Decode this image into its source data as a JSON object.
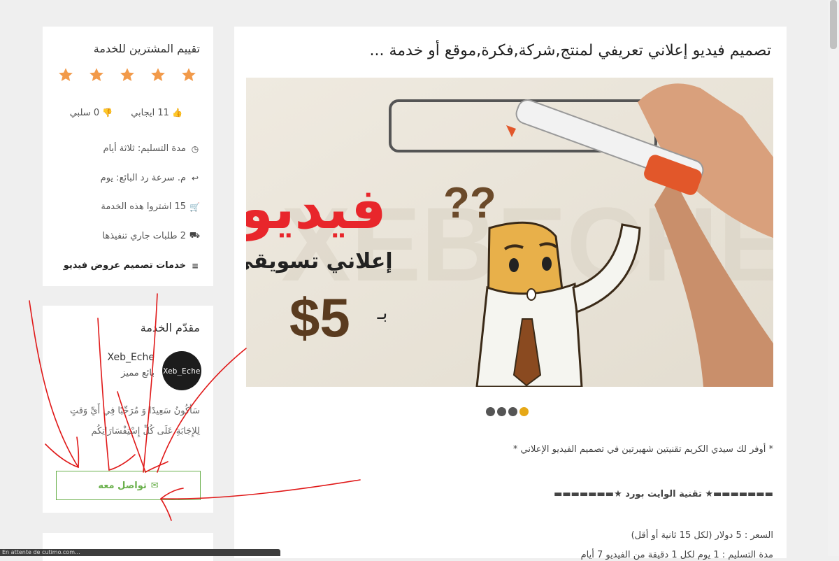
{
  "main": {
    "title": "تصميم فيديو إعلاني تعريفي لمنتج,شركة,فكرة,موقع أو خدمة ...",
    "hero": {
      "big_word": "فيديو",
      "sub_word": "إعلاني تسويقي",
      "price_prefix": "بـ",
      "price": "$5",
      "watermark": "XEBECHE",
      "question_marks": "??"
    },
    "slides": 4,
    "active_slide": 4,
    "description": [
      "* أوفر لك سيدي الكريم تقنيتين شهيرتين في تصميم الفيديو الإعلاني *",
      "▬▬▬▬▬▬▬★ تقنية الوايت بورد ★▬▬▬▬▬▬▬",
      "السعر : 5 دولار (لكل 15 ثانية أو أقل)",
      "مدة التسليم : 1 يوم لكل 1 دقيقة من الفيديو 7 أيام"
    ]
  },
  "rating": {
    "title": "تقييم المشترين للخدمة",
    "stars": 5,
    "star_color": "#f29a4a",
    "positive": "11 ايجابي",
    "negative": "0 سلبي",
    "rows": [
      {
        "icon": "clock-icon",
        "glyph": "◷",
        "text": "مدة التسليم: ثلاثة أيام"
      },
      {
        "icon": "reply-icon",
        "glyph": "↩",
        "text": "م. سرعة رد البائع: يوم"
      },
      {
        "icon": "cart-icon",
        "glyph": "🛒",
        "text": "15 اشتروا هذه الخدمة"
      },
      {
        "icon": "truck-icon",
        "glyph": "⛟",
        "text": "2 طلبات جاري تنفيذها"
      },
      {
        "icon": "list-icon",
        "glyph": "≡",
        "text": "خدمات تصميم عروض فيديو"
      }
    ]
  },
  "provider": {
    "title": "مقدّم الخدمة",
    "name": "Xeb_Eche",
    "level": "بائع مميز",
    "avatar_text": "Xeb_Eche",
    "bio_line1": "سَأكُونُ سَعِيدًا وَ مُرَحِّبًا فِي أَيِّ وَقتٍ",
    "bio_line2": "لِلإِجَابَةِ عَلَى كُلِّ إِسْتِفْسَارَاتِكُم",
    "contact_label": "تواصل معه",
    "accent": "#6ab04c"
  },
  "status_bar": "En attente de cutimo.com..."
}
